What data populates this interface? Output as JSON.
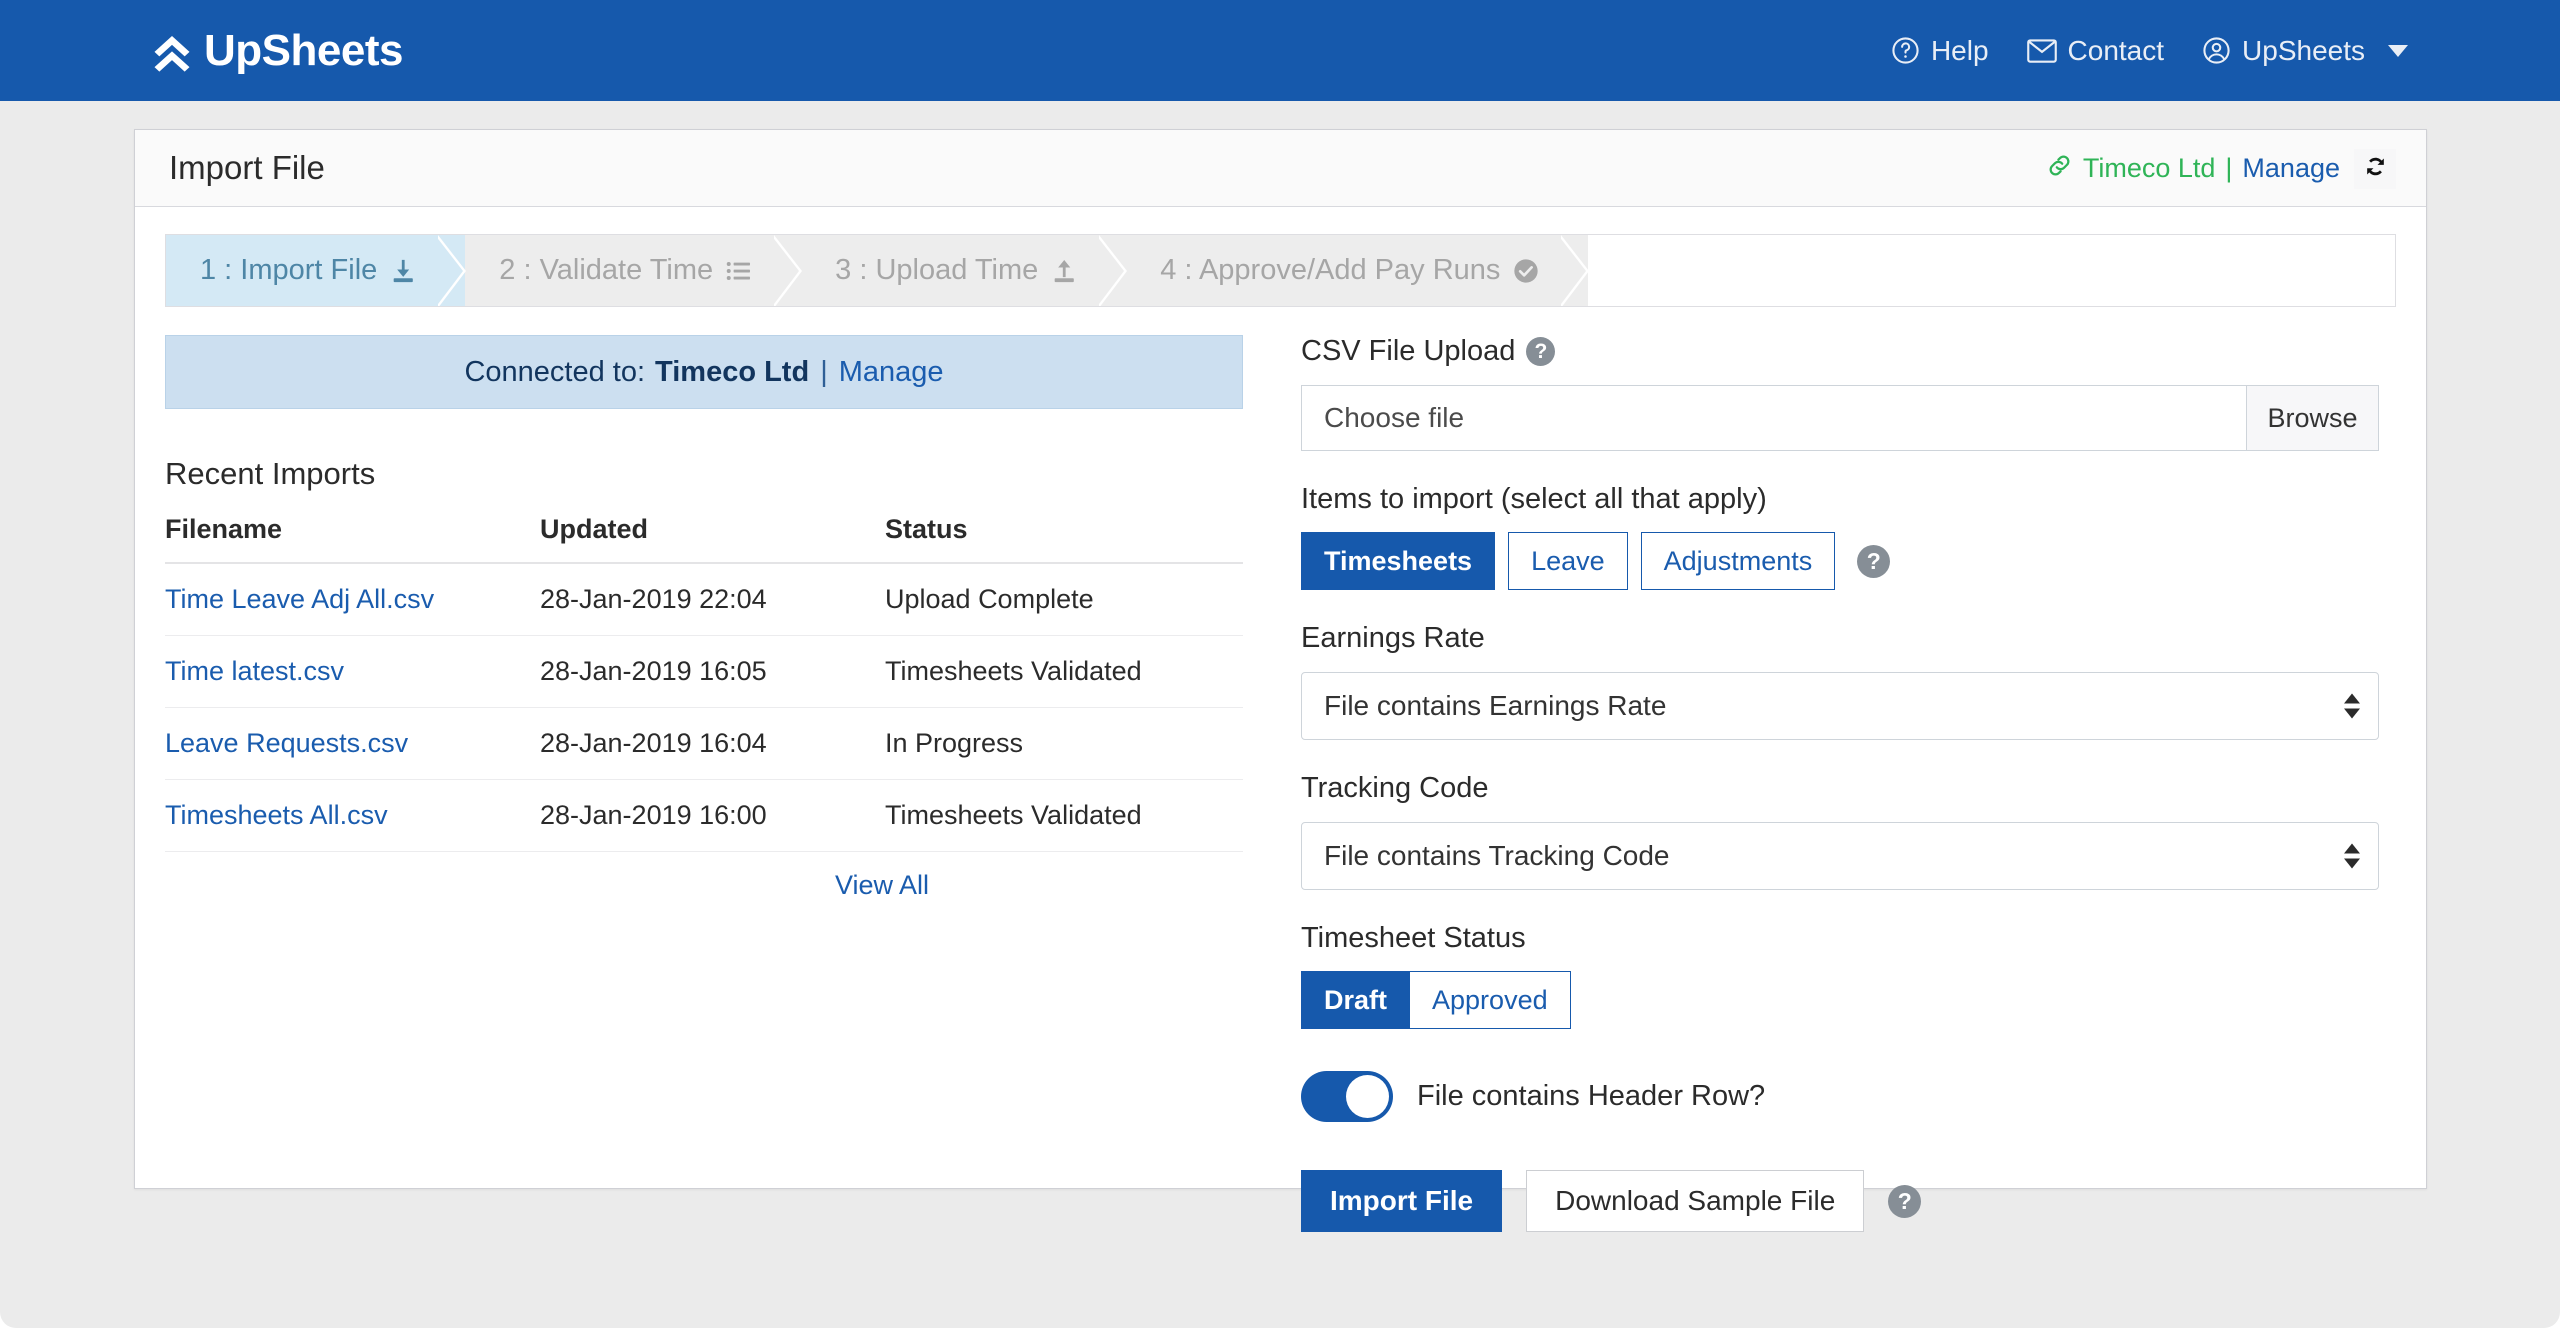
{
  "brand": {
    "name": "UpSheets",
    "icon": "double-chevron-up-icon"
  },
  "nav": {
    "items": [
      {
        "label": "Help",
        "icon": "question-circle-icon"
      },
      {
        "label": "Contact",
        "icon": "envelope-icon"
      },
      {
        "label": "UpSheets",
        "icon": "user-circle-icon",
        "caret": "chevron-down-icon"
      }
    ]
  },
  "card": {
    "title": "Import File",
    "connection": {
      "icon": "link-icon",
      "org": "Timeco Ltd",
      "separator": "|",
      "manage_label": "Manage",
      "refresh_icon": "refresh-icon"
    }
  },
  "stepper": {
    "steps": [
      {
        "label": "1 : Import File",
        "icon": "download-icon",
        "active": true
      },
      {
        "label": "2 : Validate Time",
        "icon": "list-icon",
        "active": false
      },
      {
        "label": "3 : Upload Time",
        "icon": "upload-icon",
        "active": false
      },
      {
        "label": "4 : Approve/Add Pay Runs",
        "icon": "check-circle-icon",
        "active": false
      }
    ]
  },
  "alert": {
    "prefix": "Connected to:",
    "org": "Timeco Ltd",
    "separator": "|",
    "manage_label": "Manage"
  },
  "recent_imports": {
    "heading": "Recent Imports",
    "columns": [
      "Filename",
      "Updated",
      "Status"
    ],
    "rows": [
      {
        "filename": "Time Leave Adj All.csv",
        "updated": "28-Jan-2019 22:04",
        "status": "Upload Complete"
      },
      {
        "filename": "Time latest.csv",
        "updated": "28-Jan-2019 16:05",
        "status": "Timesheets Validated"
      },
      {
        "filename": "Leave Requests.csv",
        "updated": "28-Jan-2019 16:04",
        "status": "In Progress"
      },
      {
        "filename": "Timesheets All.csv",
        "updated": "28-Jan-2019 16:00",
        "status": "Timesheets Validated"
      }
    ],
    "view_all_label": "View All"
  },
  "upload": {
    "label": "CSV File Upload",
    "help_icon": "question-circle-filled-icon",
    "file_value": "Choose file",
    "browse_label": "Browse"
  },
  "items_to_import": {
    "label": "Items to import (select all that apply)",
    "options": [
      {
        "label": "Timesheets",
        "selected": true
      },
      {
        "label": "Leave",
        "selected": false
      },
      {
        "label": "Adjustments",
        "selected": false
      }
    ],
    "help_icon": "question-circle-filled-icon"
  },
  "earnings_rate": {
    "label": "Earnings Rate",
    "value": "File contains Earnings Rate"
  },
  "tracking_code": {
    "label": "Tracking Code",
    "value": "File contains Tracking Code"
  },
  "timesheet_status": {
    "label": "Timesheet Status",
    "options": [
      {
        "label": "Draft",
        "selected": true
      },
      {
        "label": "Approved",
        "selected": false
      }
    ]
  },
  "header_row": {
    "label": "File contains Header Row?",
    "enabled": true
  },
  "actions": {
    "import_label": "Import File",
    "download_sample_label": "Download Sample File",
    "help_icon": "question-circle-filled-icon"
  },
  "colors": {
    "navbar_blue": "#1659ac",
    "link_blue": "#1a5cae",
    "green": "#2fb457",
    "page_bg": "#ebebeb",
    "step_active_bg": "#d4e9f5",
    "alert_bg": "#ccdff0"
  }
}
